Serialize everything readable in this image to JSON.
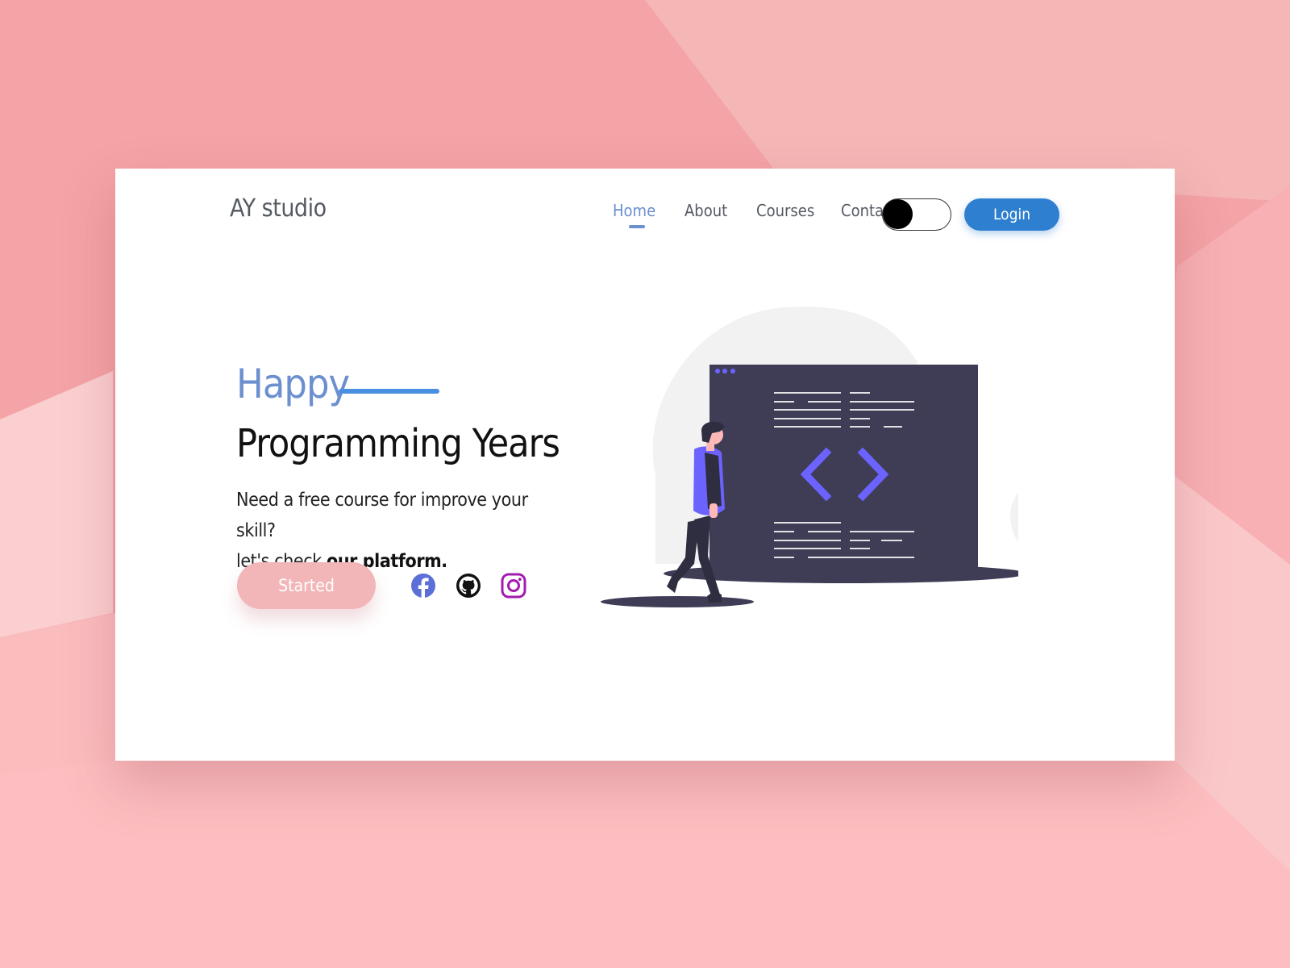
{
  "brand": {
    "name": "AY studio"
  },
  "nav": {
    "items": [
      {
        "label": "Home",
        "active": true
      },
      {
        "label": "About",
        "active": false
      },
      {
        "label": "Courses",
        "active": false
      },
      {
        "label": "Contact",
        "active": false
      }
    ]
  },
  "header": {
    "theme_toggle": {
      "state": "off",
      "icon": "toggle-switch"
    },
    "login_label": "Login"
  },
  "hero": {
    "happy": "Happy",
    "title": "Programming Years",
    "desc_line1": "Need a free course for improve your skill?",
    "desc_line2_prefix": "let's check ",
    "desc_line2_bold": "our platform."
  },
  "cta": {
    "started_label": "Started"
  },
  "social": [
    {
      "name": "facebook-icon",
      "color": "#5b6fd6"
    },
    {
      "name": "github-icon",
      "color": "#111111"
    },
    {
      "name": "instagram-icon",
      "color": "#a21caf"
    }
  ],
  "colors": {
    "page_bg": "#f4a6a8",
    "accent_blue": "#6b8fcf",
    "login_blue": "#2f7fd1",
    "started_pink": "#f2b5b8",
    "illustration_dark": "#3f3d56",
    "illustration_purple": "#6c63ff"
  }
}
